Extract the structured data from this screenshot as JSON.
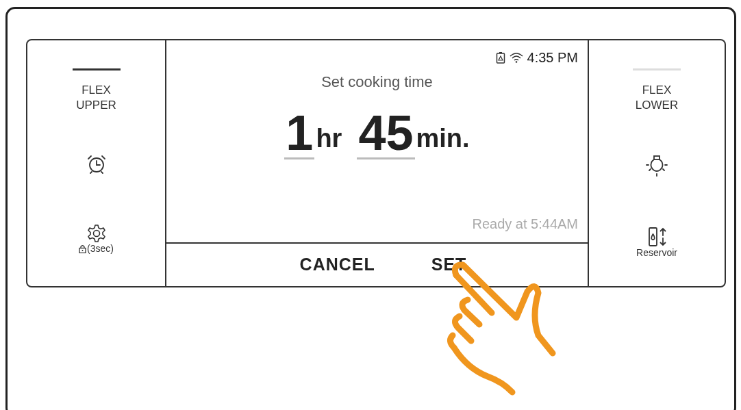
{
  "left_panel": {
    "zone": {
      "label": "FLEX\nUPPER",
      "selected": true
    },
    "buttons": [
      {
        "kind": "timer"
      },
      {
        "kind": "settings",
        "label": "(3sec)"
      }
    ]
  },
  "display": {
    "status_bar": {
      "time": "4:35 PM"
    },
    "title": "Set cooking time",
    "time_value": {
      "hours": "1",
      "hours_unit": "hr",
      "minutes": "45",
      "minutes_unit": "min."
    },
    "ready_text": "Ready at 5:44AM",
    "actions": [
      {
        "label": "CANCEL"
      },
      {
        "label": "SET"
      }
    ]
  },
  "right_panel": {
    "zone": {
      "label": "FLEX\nLOWER",
      "selected": false
    },
    "buttons": [
      {
        "kind": "light"
      },
      {
        "kind": "reservoir",
        "label": "Reservoir"
      }
    ]
  }
}
